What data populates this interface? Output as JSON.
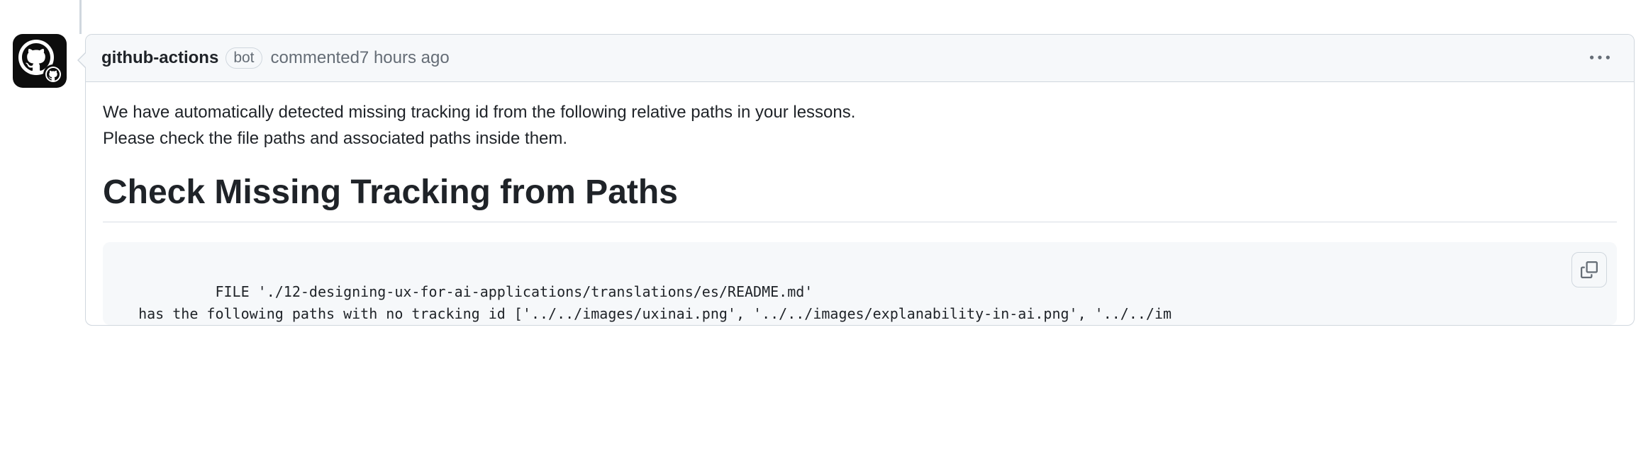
{
  "comment": {
    "author": "github-actions",
    "bot_label": "bot",
    "action_text": "commented ",
    "timestamp": "7 hours ago",
    "body": {
      "intro_line1": "We have automatically detected missing tracking id from the following relative paths in your lessons.",
      "intro_line2": "Please check the file paths and associated paths inside them.",
      "heading": "Check Missing Tracking from Paths",
      "code_line1": "   FILE './12-designing-ux-for-ai-applications/translations/es/README.md'",
      "code_line2": "  has the following paths with no tracking id ['../../images/uxinai.png', '../../images/explanability-in-ai.png', '../../im"
    }
  }
}
